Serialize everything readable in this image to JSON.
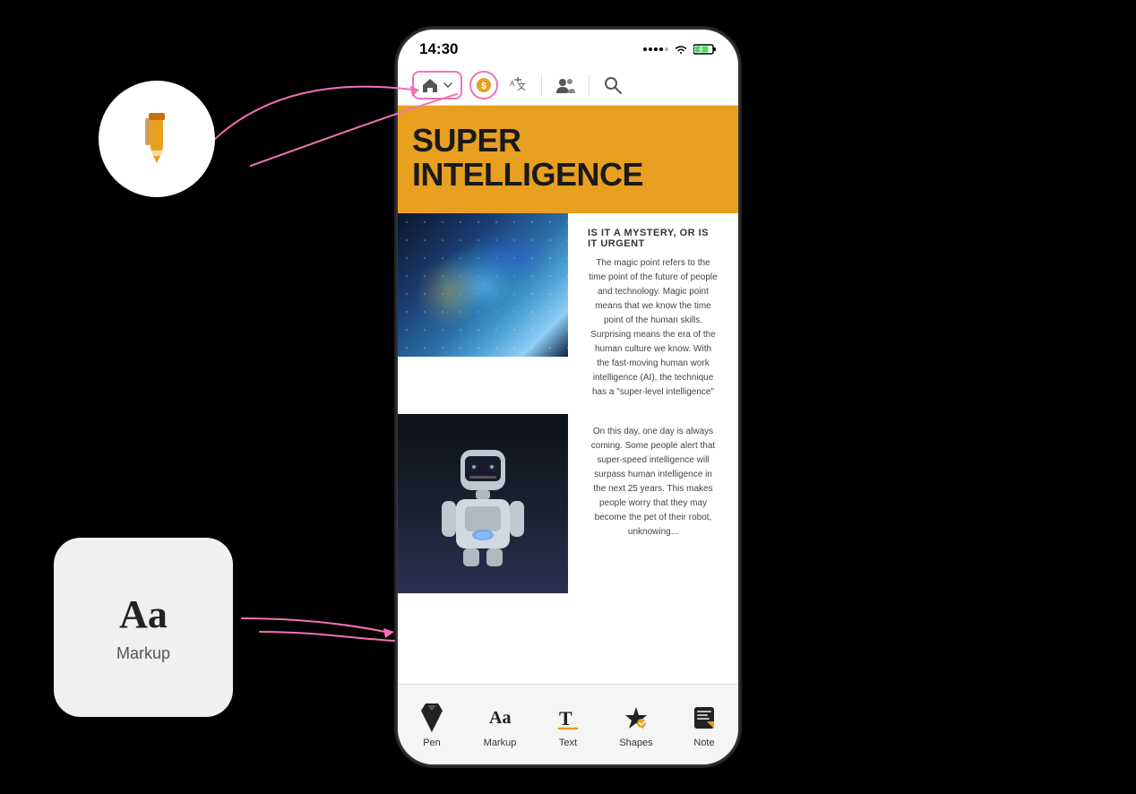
{
  "phone": {
    "statusBar": {
      "time": "14:30",
      "dots": [
        1,
        1,
        1,
        1,
        1
      ],
      "wifi": "📶",
      "battery": "⚡"
    },
    "toolbar": {
      "homeIcon": "🏠",
      "chevron": "▾",
      "coinIcon": "💰",
      "translateIcon": "🔤",
      "usersIcon": "👥",
      "searchIcon": "🔍"
    },
    "magazine": {
      "title": "SUPER INTELLIGENCE",
      "subtitle": "IS IT A MYSTERY, OR IS IT URGENT",
      "bodyText1": "The magic point refers to the time point of the future of people and technology. Magic point means that we know the time point of the human skills. Surprising means the era of the human culture we know. With the fast-moving human work intelligence (AI), the technique has a \"super-level intelligence\"",
      "bodyText2": "On this day, one day is always coming. Some people alert that super-speed intelligence will surpass human intelligence in the next 25 years. This makes people worry that they may become the pet of their robot, unknowing..."
    },
    "bottomToolbar": {
      "tools": [
        {
          "id": "pen",
          "label": "Pen",
          "icon": "pen"
        },
        {
          "id": "markup",
          "label": "Markup",
          "icon": "markup"
        },
        {
          "id": "text",
          "label": "Text",
          "icon": "text"
        },
        {
          "id": "shapes",
          "label": "Shapes",
          "icon": "shapes"
        },
        {
          "id": "note",
          "label": "Note",
          "icon": "note"
        }
      ]
    }
  },
  "floatingCircles": {
    "pen": {
      "ariaLabel": "Pen tool icon"
    },
    "markup": {
      "title": "Aa",
      "label": "Markup"
    }
  },
  "colors": {
    "accent": "#f472b6",
    "gold": "#e8a020",
    "penIconColor": "#e8a020"
  }
}
